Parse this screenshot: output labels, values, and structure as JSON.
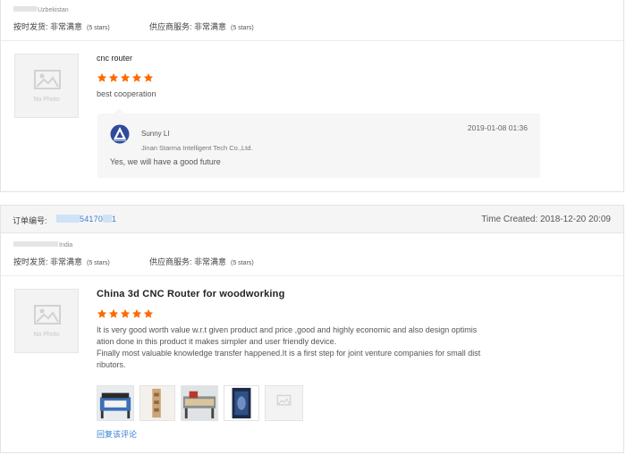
{
  "review1": {
    "buyer_country": "Uzbekistan",
    "on_time_label": "按时发货: 非常满意",
    "on_time_stars": "(5 stars)",
    "service_label": "供应商服务: 非常满意",
    "service_stars": "(5 stars)",
    "no_photo": "No Photo",
    "product_title": "cnc router",
    "rating": 5,
    "review_text": "best cooperation",
    "reply": {
      "supplier_name": "Sunny LI",
      "company": "Jinan Starma Intelligent Tech Co.,Ltd.",
      "time": "2019-01-08 01:36",
      "text": "Yes, we will have a good future"
    }
  },
  "review2": {
    "order_label": "订单编号:",
    "order_number_visible_middle": "54170",
    "order_number_visible_end": "1",
    "time_created": "Time Created: 2018-12-20 20:09",
    "buyer_country": "India",
    "on_time_label": "按时发货: 非常满意",
    "on_time_stars": "(5 stars)",
    "service_label": "供应商服务: 非常满意",
    "service_stars": "(5 stars)",
    "no_photo": "No Photo",
    "product_title": "China 3d CNC Router for woodworking",
    "rating": 5,
    "review_line1": "It is very good worth value w.r.t given product and price ,good and highly economic and also design optimis",
    "review_line2": "ation done in this product it makes simpler and user friendly device.",
    "review_line3": "Finally most valuable knowledge transfer happened.It is a first step for joint venture companies for small dist",
    "review_line4": "ributors.",
    "reply_link": "回复该评论"
  },
  "colors": {
    "star": "#ff6a00",
    "link": "#3a7fd5",
    "panel": "#f6f6f6"
  }
}
